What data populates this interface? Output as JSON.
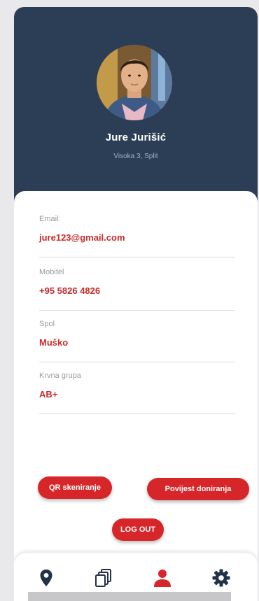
{
  "profile": {
    "name": "Jure Jurišić",
    "address": "Visoka 3, Split"
  },
  "fields": [
    {
      "label": "Email:",
      "value": "jure123@gmail.com"
    },
    {
      "label": "Mobitel",
      "value": "+95 5826 4826"
    },
    {
      "label": "Spol",
      "value": "Muško"
    },
    {
      "label": "Krvna grupa",
      "value": "AB+"
    }
  ],
  "actions": {
    "qr_label": "QR skeniranje",
    "history_label": "Povijest doniranja",
    "logout_label": "LOG OUT"
  },
  "nav": {
    "items": [
      {
        "icon": "location-pin-icon",
        "active": false
      },
      {
        "icon": "cards-icon",
        "active": false
      },
      {
        "icon": "person-icon",
        "active": true
      },
      {
        "icon": "gear-icon",
        "active": false
      }
    ]
  },
  "colors": {
    "header": "#2c3e55",
    "accent": "#d7262a",
    "value_text": "#cc2b2b",
    "nav_icon": "#223247"
  }
}
